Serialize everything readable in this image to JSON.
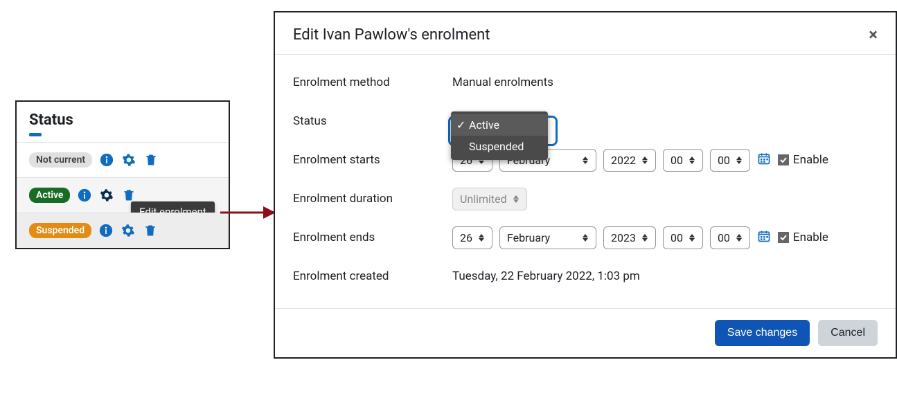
{
  "status_panel": {
    "title": "Status",
    "rows": [
      {
        "label": "Not current",
        "badge_class": "badge-grey"
      },
      {
        "label": "Active",
        "badge_class": "badge-green"
      },
      {
        "label": "Suspended",
        "badge_class": "badge-orange"
      }
    ],
    "tooltip": "Edit enrolment"
  },
  "dialog": {
    "title": "Edit Ivan Pawlow's enrolment",
    "fields": {
      "method_label": "Enrolment method",
      "method_value": "Manual enrolments",
      "status_label": "Status",
      "status_options": {
        "active": "Active",
        "suspended": "Suspended"
      },
      "starts_label": "Enrolment starts",
      "starts": {
        "day": "26",
        "month": "February",
        "year": "2022",
        "hour": "00",
        "minute": "00",
        "enable": "Enable"
      },
      "duration_label": "Enrolment duration",
      "duration_value": "Unlimited",
      "ends_label": "Enrolment ends",
      "ends": {
        "day": "26",
        "month": "February",
        "year": "2023",
        "hour": "00",
        "minute": "00",
        "enable": "Enable"
      },
      "created_label": "Enrolment created",
      "created_value": "Tuesday, 22 February 2022, 1:03 pm"
    },
    "buttons": {
      "save": "Save changes",
      "cancel": "Cancel"
    }
  }
}
